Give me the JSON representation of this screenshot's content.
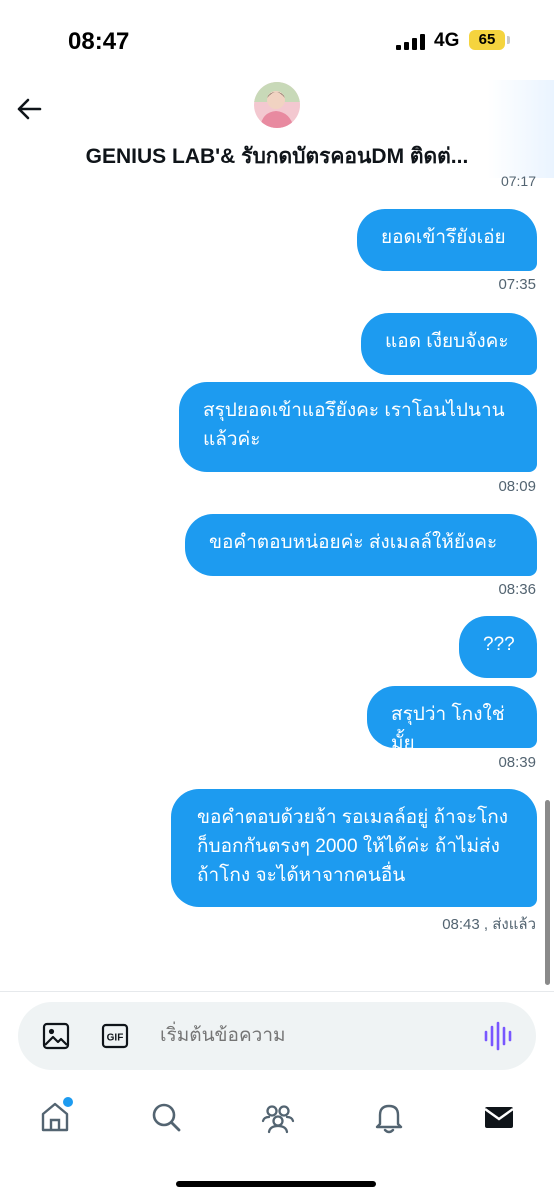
{
  "status_bar": {
    "time": "08:47",
    "network": "4G",
    "battery": "65"
  },
  "header": {
    "title": "GENIUS LAB'& รับกดบัตรคอนDM ติดต่...",
    "cut_timestamp": "07:17"
  },
  "messages": [
    {
      "text": "ยอดเข้ารึยังเอ่ย",
      "time": "07:35"
    },
    {
      "text": "แอด เงียบจังคะ",
      "time": ""
    },
    {
      "text": "สรุปยอดเข้าแอรึยังคะ เราโอนไปนาน แล้วค่ะ",
      "time": "08:09"
    },
    {
      "text": "ขอคำตอบหน่อยค่ะ ส่งเมลล์ให้ยังคะ",
      "time": "08:36"
    },
    {
      "text": "???",
      "time": ""
    },
    {
      "text": "สรุปว่า โกงใช่มั้ย",
      "time": "08:39"
    },
    {
      "text": "ขอคำตอบด้วยจ้า รอเมลล์อยู่ ถ้าจะโกงก็บอกกันตรงๆ 2000 ให้ได้ค่ะ ถ้าไม่ส่ง ถ้าโกง จะได้หาจากคนอื่น",
      "time": "08:43 , ส่งแล้ว"
    }
  ],
  "composer": {
    "placeholder": "เริ่มต้นข้อความ",
    "gif_label": "GIF"
  },
  "icons": {
    "back": "arrow-left-icon",
    "media": "image-icon",
    "gif": "gif-icon",
    "voice": "waveform-icon",
    "nav": [
      "home-icon",
      "search-icon",
      "communities-icon",
      "bell-icon",
      "mail-icon"
    ]
  },
  "colors": {
    "accent": "#1d9bf0",
    "voice": "#7856ff",
    "battery": "#f5d43e",
    "muted": "#536471"
  }
}
